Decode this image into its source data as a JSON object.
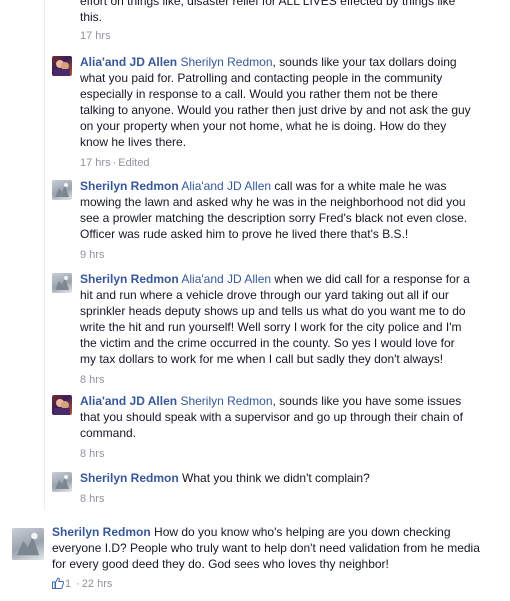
{
  "top_fragment": {
    "text": "effort on things like, disaster relief for ALL LIVES effected by things like this.",
    "time": "17 hrs"
  },
  "comments": [
    {
      "author": "Alia'and JD Allen",
      "tag": "Sherilyn Redmon",
      "text": ", sounds like your tax dollars doing what you paid for. Patrolling and contacting people in the community especially in response to a call. Would you rather them not be there talking to anyone. Would you rather then just drive by and not ask the guy on your property when your not home, what he is doing. How do they know he lives there.",
      "time": "17 hrs",
      "edited": "Edited"
    },
    {
      "author": "Sherilyn Redmon",
      "tag": "Alia'and JD Allen",
      "text": " call was for a white male he was mowing the lawn and asked why he was in the neighborhood not did you see a prowler matching the description sorry Fred's black not even close. Officer was rude asked him to prove he lived there that's B.S.!",
      "time": "9 hrs"
    },
    {
      "author": "Sherilyn Redmon",
      "tag": "Alia'and JD Allen",
      "text": " when we did call for a response for a hit and run where a vehicle drove through our yard taking out all if our sprinkler heads deputy shows up and tells us what do you want me to do write the hit and run yourself! Well sorry I work for the city police and I'm the victim and the crime occurred in the county. So yes I would love for my tax dollars to work for me when I call but sadly they don't always!",
      "time": "8 hrs"
    },
    {
      "author": "Alia'and JD Allen",
      "tag": "Sherilyn Redmon",
      "text": ", sounds like you have some issues that you should speak with a supervisor and go up through their chain of command.",
      "time": "8 hrs"
    },
    {
      "author": "Sherilyn Redmon",
      "text": "What you think we didn't complain?",
      "time": "8 hrs"
    },
    {
      "author": "Sherilyn Redmon",
      "text": "How do you know who's helping are you down checking everyone I.D? People who truly want to help don't need validation from he media for every good deed they do. God sees who loves thy neighbor!",
      "likes": "1",
      "time": "22 hrs"
    }
  ]
}
